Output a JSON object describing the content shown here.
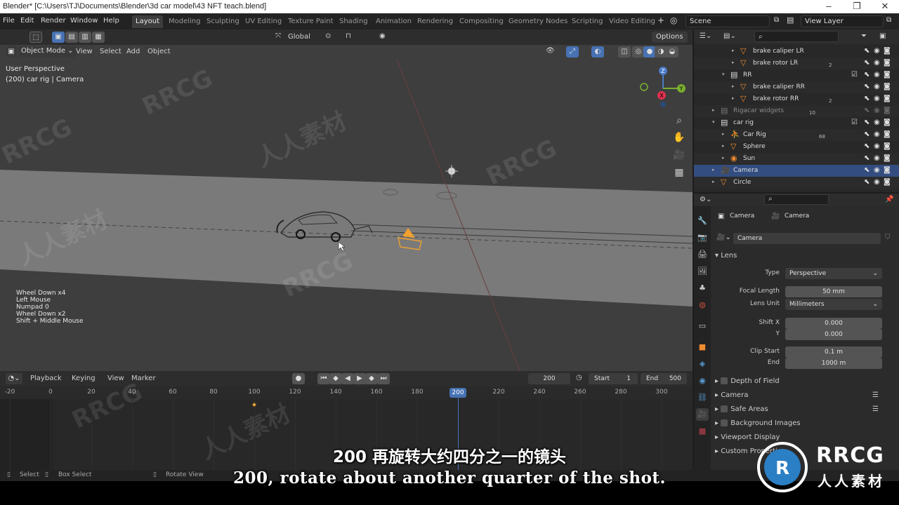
{
  "window": {
    "title": "Blender* [C:\\Users\\TJ\\Documents\\Blender\\3d car model\\43 NFT teach.blend]",
    "controls": [
      "–",
      "❐",
      "✕"
    ]
  },
  "menu": [
    "File",
    "Edit",
    "Render",
    "Window",
    "Help"
  ],
  "workspaces": [
    "Layout",
    "Modeling",
    "Sculpting",
    "UV Editing",
    "Texture Paint",
    "Shading",
    "Animation",
    "Rendering",
    "Compositing",
    "Geometry Nodes",
    "Scripting",
    "Video Editing"
  ],
  "active_workspace": "Layout",
  "scene": "Scene",
  "view_layer": "View Layer",
  "viewport": {
    "mode": "Object Mode",
    "menus": [
      "View",
      "Select",
      "Add",
      "Object"
    ],
    "orientation": "Global",
    "options": "Options",
    "perspective": "User Perspective",
    "context": "(200) car rig | Camera",
    "key_log": [
      "Wheel Down x4",
      "Left Mouse",
      "Numpad 0",
      "Wheel Down x2",
      "Shift + Middle Mouse"
    ],
    "gizmo": {
      "x": "X",
      "y": "Y",
      "z": "Z"
    }
  },
  "outliner": {
    "rows": [
      {
        "label": "brake caliper LR",
        "indent": 3,
        "icon": "mesh"
      },
      {
        "label": "brake rotor LR",
        "indent": 3,
        "icon": "mesh",
        "badge": "2"
      },
      {
        "label": "RR",
        "indent": 2,
        "icon": "collection"
      },
      {
        "label": "brake caliper RR",
        "indent": 3,
        "icon": "mesh"
      },
      {
        "label": "brake rotor RR",
        "indent": 3,
        "icon": "mesh",
        "badge": "2"
      },
      {
        "label": "Rigacar widgets",
        "indent": 1,
        "icon": "collection",
        "dim": true,
        "badge": "10"
      },
      {
        "label": "car rig",
        "indent": 1,
        "icon": "collection"
      },
      {
        "label": "Car Rig",
        "indent": 2,
        "icon": "armature",
        "badge": "68"
      },
      {
        "label": "Sphere",
        "indent": 2,
        "icon": "mesh"
      },
      {
        "label": "Sun",
        "indent": 2,
        "icon": "light"
      },
      {
        "label": "Camera",
        "indent": 1,
        "icon": "camera",
        "selected": true
      },
      {
        "label": "Circle",
        "indent": 1,
        "icon": "curve"
      }
    ]
  },
  "properties": {
    "breadcrumb_object": "Camera",
    "breadcrumb_data": "Camera",
    "datablock": "Camera",
    "lens_section": "Lens",
    "type_label": "Type",
    "type_value": "Perspective",
    "focal_label": "Focal Length",
    "focal_value": "50 mm",
    "lens_unit_label": "Lens Unit",
    "lens_unit_value": "Millimeters",
    "shiftx_label": "Shift X",
    "shiftx_value": "0.000",
    "shifty_label": "Y",
    "shifty_value": "0.000",
    "clip_start_label": "Clip Start",
    "clip_start_value": "0.1 m",
    "clip_end_label": "End",
    "clip_end_value": "1000 m",
    "sections": [
      "Depth of Field",
      "Camera",
      "Safe Areas",
      "Background Images",
      "Viewport Display",
      "Custom Properties"
    ]
  },
  "timeline": {
    "menus": [
      "Playback",
      "Keying",
      "View",
      "Marker"
    ],
    "current_frame": "200",
    "start_label": "Start",
    "start": "1",
    "end_label": "End",
    "end": "500",
    "ticks": [
      "-20",
      "0",
      "20",
      "40",
      "60",
      "80",
      "100",
      "120",
      "140",
      "160",
      "180",
      "200",
      "220",
      "240",
      "260",
      "280",
      "300"
    ],
    "keyframe": 100,
    "playhead": 200
  },
  "statusbar": {
    "select": "Select",
    "box_select": "Box Select",
    "rotate_view": "Rotate View"
  },
  "subtitles": {
    "chinese": "200 再旋转大约四分之一的镜头",
    "english": "200, rotate about another quarter of the shot."
  },
  "watermark": {
    "brand": "RRCG",
    "brand_cn": "人人素材"
  },
  "colors": {
    "selection": "#4772b3",
    "playhead": "#4772b3",
    "keyframe": "#e8a33c",
    "camera_selected": "#f0a030"
  }
}
